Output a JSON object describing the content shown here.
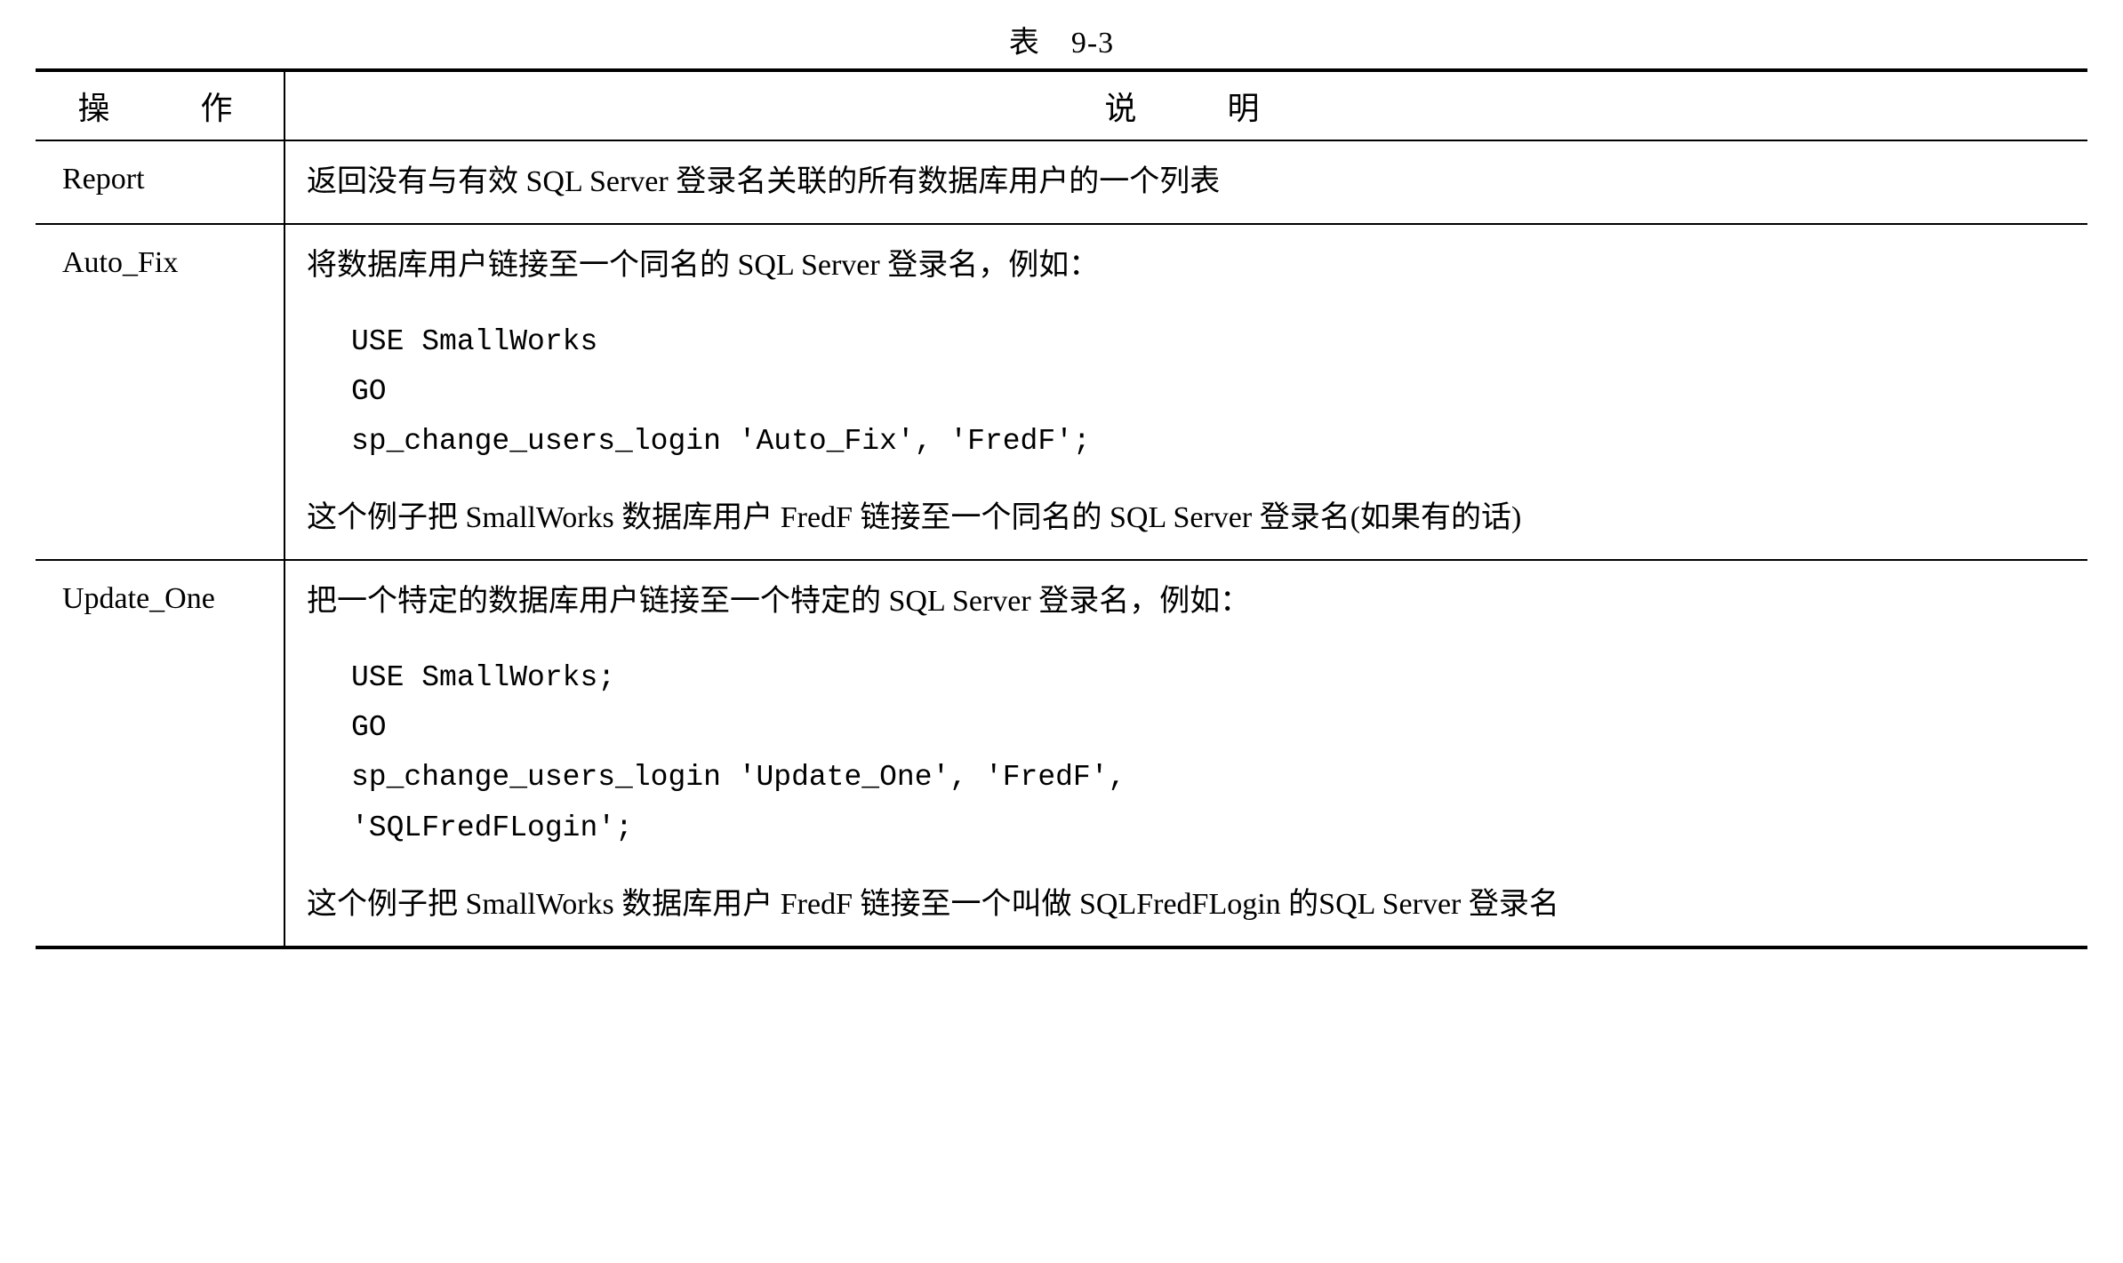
{
  "table": {
    "caption": "表　9-3",
    "header": {
      "col1": "操　　作",
      "col2": "说　　明"
    },
    "rows": [
      {
        "operation": "Report",
        "desc_before": "返回没有与有效 SQL Server 登录名关联的所有数据库用户的一个列表",
        "code": "",
        "desc_after": ""
      },
      {
        "operation": "Auto_Fix",
        "desc_before": "将数据库用户链接至一个同名的 SQL Server 登录名，例如：",
        "code": "USE SmallWorks\nGO\nsp_change_users_login 'Auto_Fix', 'FredF';",
        "desc_after": "这个例子把 SmallWorks 数据库用户 FredF 链接至一个同名的 SQL Server 登录名(如果有的话)"
      },
      {
        "operation": "Update_One",
        "desc_before": "把一个特定的数据库用户链接至一个特定的 SQL Server 登录名，例如：",
        "code": "USE SmallWorks;\nGO\nsp_change_users_login 'Update_One', 'FredF',\n'SQLFredFLogin';",
        "desc_after": "这个例子把 SmallWorks 数据库用户 FredF 链接至一个叫做 SQLFredFLogin 的SQL Server 登录名"
      }
    ]
  }
}
